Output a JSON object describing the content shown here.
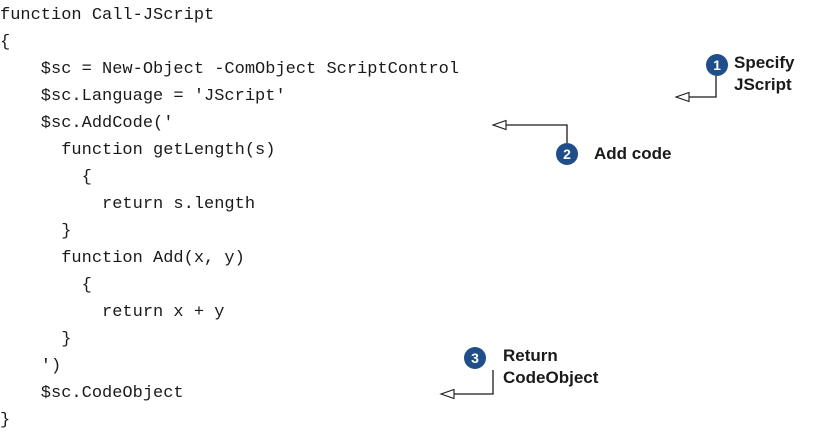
{
  "code": {
    "lines": [
      "function Call-JScript",
      "{",
      "    $sc = New-Object -ComObject ScriptControl",
      "    $sc.Language = 'JScript'",
      "    $sc.AddCode('",
      "      function getLength(s)",
      "        {",
      "          return s.length",
      "      }",
      "      function Add(x, y)",
      "        {",
      "          return x + y",
      "      }",
      "    ')",
      "    $sc.CodeObject",
      "}"
    ]
  },
  "annotations": [
    {
      "number": "1",
      "text_lines": [
        "Specify",
        "JScript"
      ]
    },
    {
      "number": "2",
      "text_lines": [
        "Add code"
      ]
    },
    {
      "number": "3",
      "text_lines": [
        "Return",
        "CodeObject"
      ]
    }
  ],
  "colors": {
    "badge": "#1f4e8a",
    "text": "#1a1a1a"
  },
  "icons": [
    "arrow-left-icon"
  ]
}
